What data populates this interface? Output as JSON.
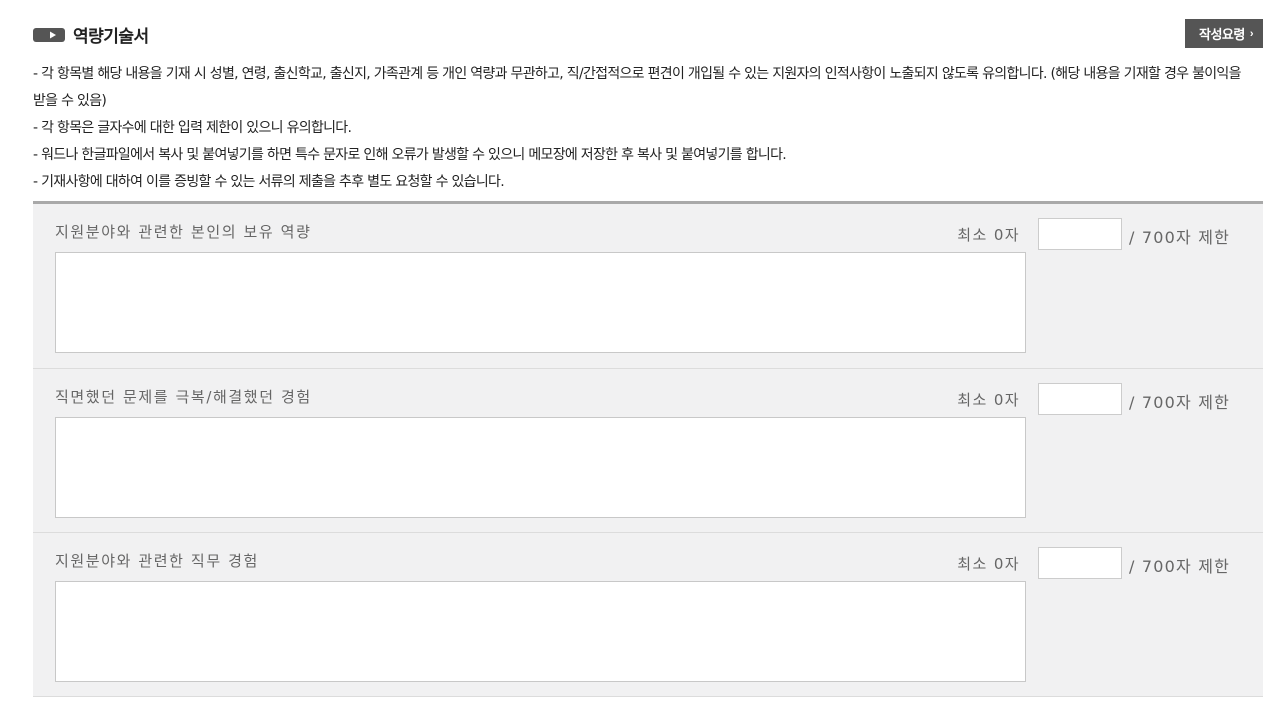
{
  "header": {
    "title": "역량기술서",
    "guide_button": "작성요령",
    "guide_arrow": "›"
  },
  "notices": [
    "- 각 항목별 해당 내용을 기재 시 성별, 연령, 출신학교, 출신지, 가족관계 등 개인 역량과 무관하고, 직/간접적으로 편견이 개입될 수 있는 지원자의 인적사항이 노출되지 않도록 유의합니다. (해당 내용을 기재할 경우 불이익을 받을 수 있음)",
    "- 각 항목은 글자수에 대한 입력 제한이 있으니 유의합니다.",
    "- 워드나 한글파일에서 복사 및 붙여넣기를 하면 특수 문자로 인해 오류가 발생할 수 있으니 메모장에 저장한 후 복사 및 붙여넣기를 합니다.",
    "- 기재사항에 대하여 이를 증빙할 수 있는 서류의 제출을 추후 별도 요청할 수 있습니다."
  ],
  "questions": [
    {
      "label": "지원분야와 관련한 본인의 보유 역량",
      "min_text": "최소 0자",
      "count_value": "",
      "limit_text": "/ 700자 제한",
      "answer": ""
    },
    {
      "label": "직면했던 문제를 극복/해결했던 경험",
      "min_text": "최소 0자",
      "count_value": "",
      "limit_text": "/ 700자 제한",
      "answer": ""
    },
    {
      "label": "지원분야와 관련한 직무 경험",
      "min_text": "최소 0자",
      "count_value": "",
      "limit_text": "/ 700자 제한",
      "answer": ""
    }
  ],
  "colors": {
    "section_bg": "#f1f1f2",
    "button_bg": "#555555",
    "icon_color": "#555555"
  }
}
